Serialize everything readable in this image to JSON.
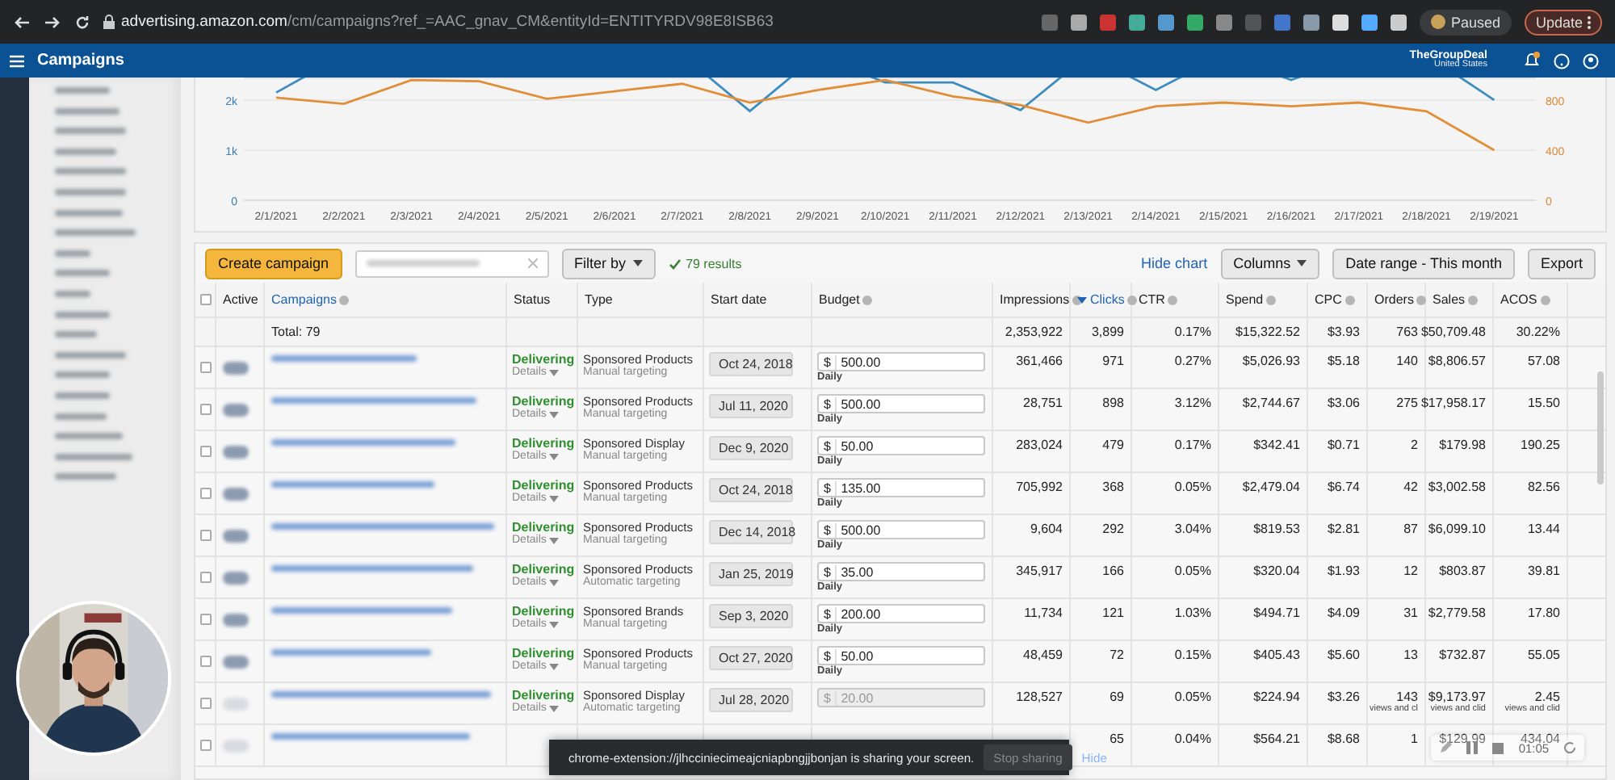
{
  "browser": {
    "url_host": "advertising.amazon.com",
    "url_path": "/cm/campaigns?ref_=AAC_gnav_CM&entityId=ENTITYRDV98E8ISB63",
    "profile_label": "Paused",
    "update_label": "Update"
  },
  "header": {
    "title": "Campaigns",
    "account": "TheGroupDeal",
    "region": "United States",
    "notification": true
  },
  "chart": {
    "chart_data": {
      "type": "line",
      "x": [
        "2/1/2021",
        "2/2/2021",
        "2/3/2021",
        "2/4/2021",
        "2/5/2021",
        "2/6/2021",
        "2/7/2021",
        "2/8/2021",
        "2/9/2021",
        "2/10/2021",
        "2/11/2021",
        "2/12/2021",
        "2/13/2021",
        "2/14/2021",
        "2/15/2021",
        "2/16/2021",
        "2/17/2021",
        "2/18/2021",
        "2/19/2021"
      ],
      "series": [
        {
          "color": "#3d8dbf",
          "values": [
            2150,
            null,
            null,
            null,
            null,
            null,
            null,
            1780,
            null,
            2350,
            2350,
            1800,
            null,
            2200,
            null,
            2400,
            null,
            null,
            2000
          ]
        },
        {
          "color": "#e08e38",
          "axis": "y2",
          "values": [
            820,
            770,
            960,
            950,
            810,
            870,
            930,
            780,
            880,
            960,
            830,
            760,
            620,
            750,
            780,
            750,
            780,
            710,
            400
          ]
        }
      ],
      "ylim": [
        0,
        2450
      ],
      "yticks": [
        0,
        {
          "value": 1000,
          "label": "1k"
        },
        {
          "value": 2000,
          "label": "2k"
        }
      ],
      "y2lim": [
        0,
        980
      ],
      "y2ticks": [
        0,
        400,
        800
      ]
    }
  },
  "toolbar": {
    "create_label": "Create campaign",
    "filter_label": "Filter by",
    "results": "79 results",
    "hide_chart": "Hide chart",
    "columns_label": "Columns",
    "date_range_label": "Date range - This month",
    "export_label": "Export"
  },
  "select_all_checked": false,
  "columns": [
    {
      "label": "Active",
      "info": false,
      "sorted": false
    },
    {
      "label": "Campaigns",
      "info": true,
      "sorted": false
    },
    {
      "label": "Status",
      "info": false,
      "sorted": false
    },
    {
      "label": "Type",
      "info": false,
      "sorted": false
    },
    {
      "label": "Start date",
      "info": false,
      "sorted": false
    },
    {
      "label": "Budget",
      "info": true,
      "sorted": false
    },
    {
      "label": "Impressions",
      "info": true,
      "sorted": false
    },
    {
      "label": "Clicks",
      "info": true,
      "sorted": true
    },
    {
      "label": "CTR",
      "info": true,
      "sorted": false
    },
    {
      "label": "Spend",
      "info": true,
      "sorted": false
    },
    {
      "label": "CPC",
      "info": true,
      "sorted": false
    },
    {
      "label": "Orders",
      "info": true,
      "sorted": false
    },
    {
      "label": "Sales",
      "info": true,
      "sorted": false
    },
    {
      "label": "ACOS",
      "info": true,
      "sorted": false
    }
  ],
  "total": {
    "label": "Total: 79",
    "impressions": "2,353,922",
    "clicks": "3,899",
    "ctr": "0.17%",
    "spend": "$15,322.52",
    "cpc": "$3.93",
    "orders": "763",
    "sales": "$50,709.48",
    "acos": "30.22%"
  },
  "rows": [
    {
      "checked": false,
      "active": true,
      "status": "Delivering",
      "details": "Details",
      "type": "Sponsored Products",
      "targeting": "Manual targeting",
      "start_date": "Oct 24, 2018",
      "currency": "$",
      "budget": "500.00",
      "budget_disabled": false,
      "period": "Daily",
      "impressions": "361,466",
      "clicks": "971",
      "ctr": "0.27%",
      "spend": "$5,026.93",
      "cpc": "$5.18",
      "orders": "140",
      "sales": "$8,806.57",
      "acos": "57.08"
    },
    {
      "checked": false,
      "active": true,
      "status": "Delivering",
      "details": "Details",
      "type": "Sponsored Products",
      "targeting": "Manual targeting",
      "start_date": "Jul 11, 2020",
      "currency": "$",
      "budget": "500.00",
      "budget_disabled": false,
      "period": "Daily",
      "impressions": "28,751",
      "clicks": "898",
      "ctr": "3.12%",
      "spend": "$2,744.67",
      "cpc": "$3.06",
      "orders": "275",
      "sales": "$17,958.17",
      "acos": "15.50"
    },
    {
      "checked": false,
      "active": true,
      "status": "Delivering",
      "details": "Details",
      "type": "Sponsored Display",
      "targeting": "Manual targeting",
      "start_date": "Dec 9, 2020",
      "currency": "$",
      "budget": "50.00",
      "budget_disabled": false,
      "period": "Daily",
      "impressions": "283,024",
      "clicks": "479",
      "ctr": "0.17%",
      "spend": "$342.41",
      "cpc": "$0.71",
      "orders": "2",
      "sales": "$179.98",
      "acos": "190.25"
    },
    {
      "checked": false,
      "active": true,
      "status": "Delivering",
      "details": "Details",
      "type": "Sponsored Products",
      "targeting": "Manual targeting",
      "start_date": "Oct 24, 2018",
      "currency": "$",
      "budget": "135.00",
      "budget_disabled": false,
      "period": "Daily",
      "impressions": "705,992",
      "clicks": "368",
      "ctr": "0.05%",
      "spend": "$2,479.04",
      "cpc": "$6.74",
      "orders": "42",
      "sales": "$3,002.58",
      "acos": "82.56"
    },
    {
      "checked": false,
      "active": true,
      "status": "Delivering",
      "details": "Details",
      "type": "Sponsored Products",
      "targeting": "Manual targeting",
      "start_date": "Dec 14, 2018",
      "currency": "$",
      "budget": "500.00",
      "budget_disabled": false,
      "period": "Daily",
      "impressions": "9,604",
      "clicks": "292",
      "ctr": "3.04%",
      "spend": "$819.53",
      "cpc": "$2.81",
      "orders": "87",
      "sales": "$6,099.10",
      "acos": "13.44"
    },
    {
      "checked": false,
      "active": true,
      "status": "Delivering",
      "details": "Details",
      "type": "Sponsored Products",
      "targeting": "Automatic targeting",
      "start_date": "Jan 25, 2019",
      "currency": "$",
      "budget": "35.00",
      "budget_disabled": false,
      "period": "Daily",
      "impressions": "345,917",
      "clicks": "166",
      "ctr": "0.05%",
      "spend": "$320.04",
      "cpc": "$1.93",
      "orders": "12",
      "sales": "$803.87",
      "acos": "39.81"
    },
    {
      "checked": false,
      "active": true,
      "status": "Delivering",
      "details": "Details",
      "type": "Sponsored Brands",
      "targeting": "Manual targeting",
      "start_date": "Sep 3, 2020",
      "currency": "$",
      "budget": "200.00",
      "budget_disabled": false,
      "period": "Daily",
      "impressions": "11,734",
      "clicks": "121",
      "ctr": "1.03%",
      "spend": "$494.71",
      "cpc": "$4.09",
      "orders": "31",
      "sales": "$2,779.58",
      "acos": "17.80"
    },
    {
      "checked": false,
      "active": true,
      "status": "Delivering",
      "details": "Details",
      "type": "Sponsored Products",
      "targeting": "Manual targeting",
      "start_date": "Oct 27, 2020",
      "currency": "$",
      "budget": "50.00",
      "budget_disabled": false,
      "period": "Daily",
      "impressions": "48,459",
      "clicks": "72",
      "ctr": "0.15%",
      "spend": "$405.43",
      "cpc": "$5.60",
      "orders": "13",
      "sales": "$732.87",
      "acos": "55.05"
    },
    {
      "checked": false,
      "active": false,
      "status": "Delivering",
      "details": "Details",
      "type": "Sponsored Display",
      "targeting": "Automatic targeting",
      "start_date": "Jul 28, 2020",
      "currency": "$",
      "budget": "20.00",
      "budget_disabled": true,
      "impressions": "128,527",
      "clicks": "69",
      "ctr": "0.05%",
      "spend": "$224.94",
      "cpc": "$3.26",
      "orders": "143",
      "sales": "$9,173.97",
      "acos": "2.45",
      "orders_note": "views and cl",
      "sales_note": "views and clid",
      "acos_note": "views and clid"
    },
    {
      "checked": false,
      "active": false,
      "clicks": "65",
      "ctr": "0.04%",
      "spend": "$564.21",
      "cpc": "$8.68",
      "orders": "1",
      "sales": "$129.99",
      "acos": "434.04"
    }
  ],
  "share_bar": {
    "message": "chrome-extension://jlhcciniecimeajcniapbngjjbonjan is sharing your screen.",
    "stop_label": "Stop sharing",
    "hide_label": "Hide"
  },
  "recorder": {
    "time": "01:05"
  }
}
